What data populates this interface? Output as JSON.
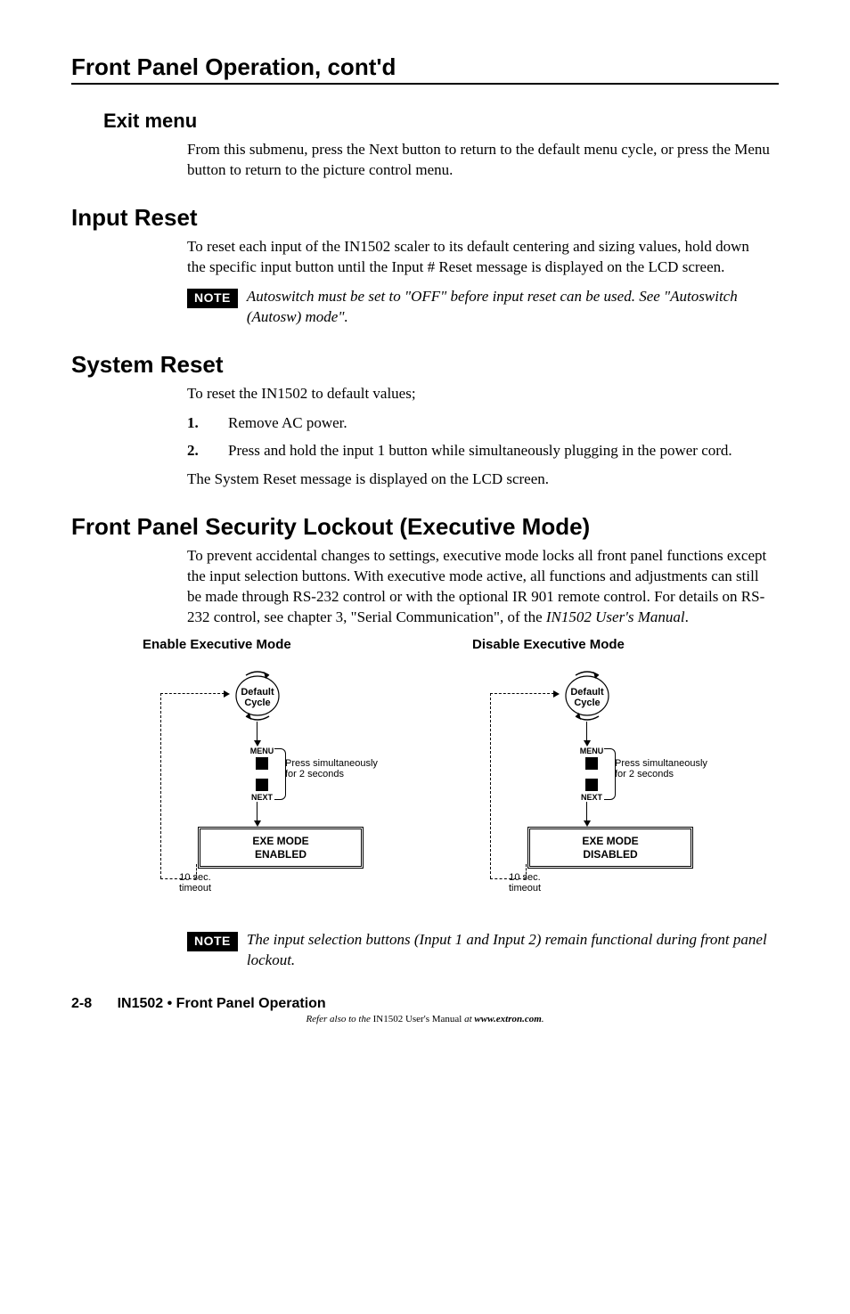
{
  "running_head": "Front Panel Operation, cont'd",
  "exit_menu": {
    "heading": "Exit menu",
    "para": "From this submenu, press the Next button to return to the default menu cycle, or press the Menu button to return to the picture control menu."
  },
  "input_reset": {
    "heading": "Input Reset",
    "para": "To reset each input of the IN1502 scaler to its default centering and sizing values, hold down the specific input button until the Input # Reset message is displayed on the LCD screen.",
    "note_label": "NOTE",
    "note": "Autoswitch must be set to \"OFF\" before input reset can be used.  See \"Autoswitch (Autosw) mode\"."
  },
  "system_reset": {
    "heading": "System Reset",
    "para1": "To reset the IN1502 to default values;",
    "steps": [
      "Remove AC power.",
      "Press and hold the input 1 button while simultaneously plugging in the power cord."
    ],
    "para2": "The System Reset message is displayed on the LCD screen."
  },
  "exec_mode": {
    "heading": "Front Panel Security Lockout (Executive Mode)",
    "para_head": "To prevent accidental changes to settings, executive mode locks all front panel functions except the input selection buttons.  With executive mode active, all functions and adjustments can still be made through RS-232 control or with the optional IR 901 remote control.  For details on RS-232 control, see chapter 3, \"Serial Communication\", of the ",
    "para_manual": "IN1502 User's Manual",
    "para_tail": ".",
    "fig_enable_title": "Enable Executive Mode",
    "fig_disable_title": "Disable Executive Mode",
    "default_cycle_l1": "Default",
    "default_cycle_l2": "Cycle",
    "menu_label": "MENU",
    "next_label": "NEXT",
    "press_l1": "Press simultaneously",
    "press_l2": "for 2 seconds",
    "box_enable_l1": "EXE MODE",
    "box_enable_l2": "ENABLED",
    "box_disable_l1": "EXE MODE",
    "box_disable_l2": "DISABLED",
    "timeout_l1": "10 sec.",
    "timeout_l2": "timeout",
    "note_label": "NOTE",
    "note": "The input selection buttons (Input 1 and Input 2) remain functional during front panel lockout."
  },
  "footer": {
    "page": "2-8",
    "title_bold": "IN1502 • ",
    "title_semi": "Front Panel Operation",
    "line2_a": "Refer also to the ",
    "line2_b": "IN1502 ",
    "line2_c": "User's Manual ",
    "line2_d": "at ",
    "line2_e": "www.extron.com",
    "line2_f": "."
  }
}
